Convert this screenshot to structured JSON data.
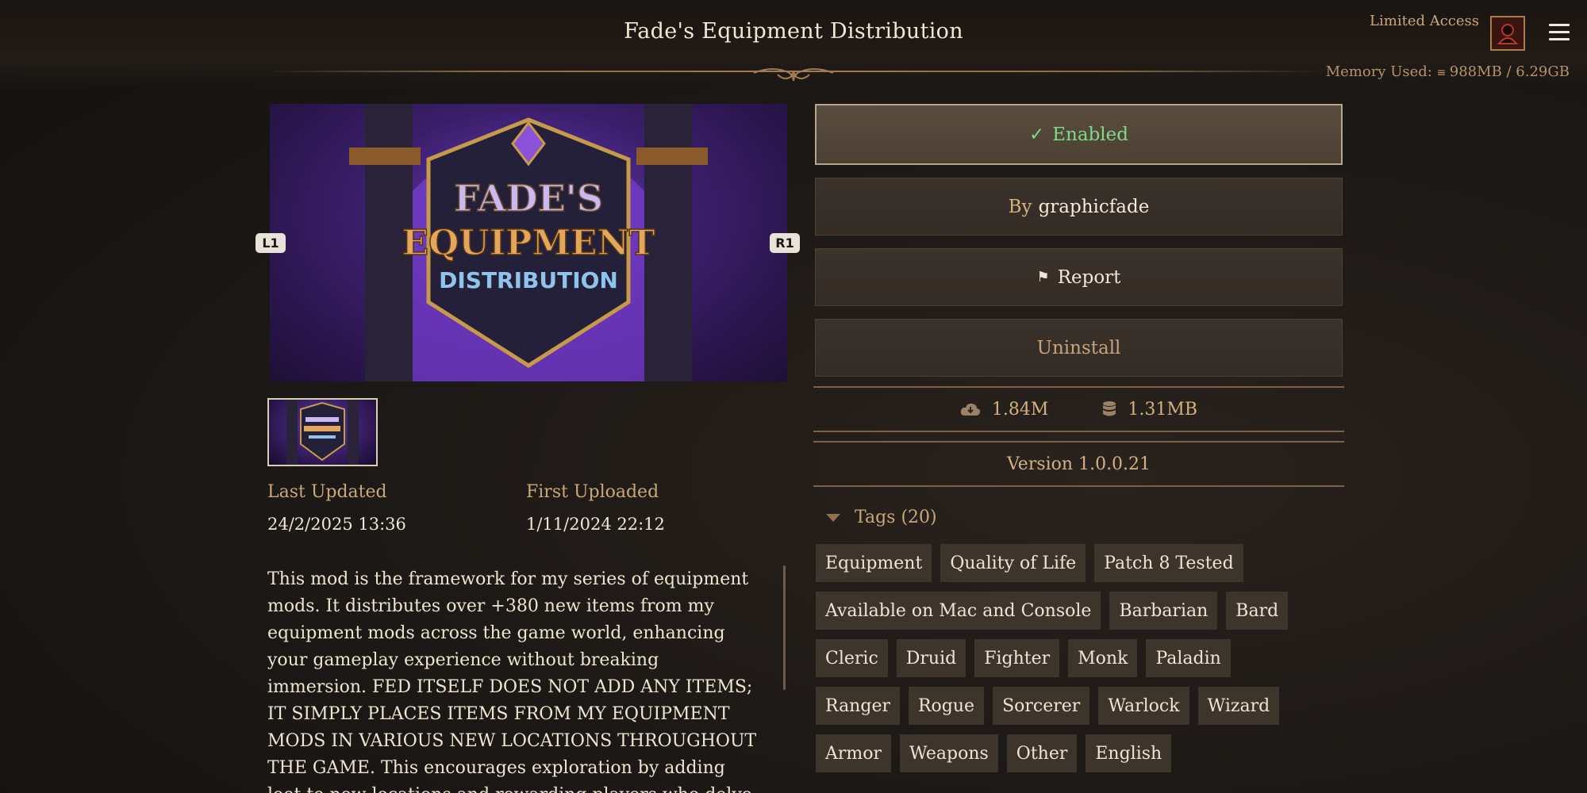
{
  "header": {
    "title": "Fade's Equipment Distribution",
    "limited_access": "Limited Access",
    "memory_label": "Memory Used:",
    "memory_value": "988MB / 6.29GB"
  },
  "gallery": {
    "prev_badge": "L1",
    "next_badge": "R1",
    "hero_logo": {
      "line1": "FADE'S",
      "line2": "EQUIPMENT",
      "line3": "DISTRIBUTION"
    }
  },
  "meta": {
    "last_updated_label": "Last Updated",
    "last_updated_value": "24/2/2025 13:36",
    "first_uploaded_label": "First Uploaded",
    "first_uploaded_value": "1/11/2024 22:12"
  },
  "description": "This mod is the framework for my series of equipment mods. It distributes over +380 new items from my equipment mods across the game world, enhancing your gameplay experience without breaking immersion. FED ITSELF DOES NOT ADD ANY ITEMS; IT SIMPLY PLACES ITEMS FROM MY EQUIPMENT MODS IN VARIOUS NEW LOCATIONS THROUGHOUT THE GAME. This encourages exploration by adding loot to new locations and rewarding players who delve into every corner of the game world. With",
  "actions": {
    "enabled_label": "Enabled",
    "author_prefix": "By",
    "author_name": "graphicfade",
    "report_label": "Report",
    "uninstall_label": "Uninstall"
  },
  "stats": {
    "downloads": "1.84M",
    "size": "1.31MB"
  },
  "version": "Version 1.0.0.21",
  "tags": {
    "header": "Tags (20)",
    "rows": [
      [
        "Equipment",
        "Quality of Life",
        "Patch 8 Tested"
      ],
      [
        "Available on Mac and Console",
        "Barbarian",
        "Bard"
      ],
      [
        "Cleric",
        "Druid",
        "Fighter",
        "Monk",
        "Paladin"
      ],
      [
        "Ranger",
        "Rogue",
        "Sorcerer",
        "Warlock",
        "Wizard"
      ],
      [
        "Armor",
        "Weapons",
        "Other",
        "English"
      ]
    ]
  },
  "colors": {
    "enabled_green": "#7dda8a",
    "accent_gold": "#c9a77a",
    "button_bg": "#3a322b"
  }
}
